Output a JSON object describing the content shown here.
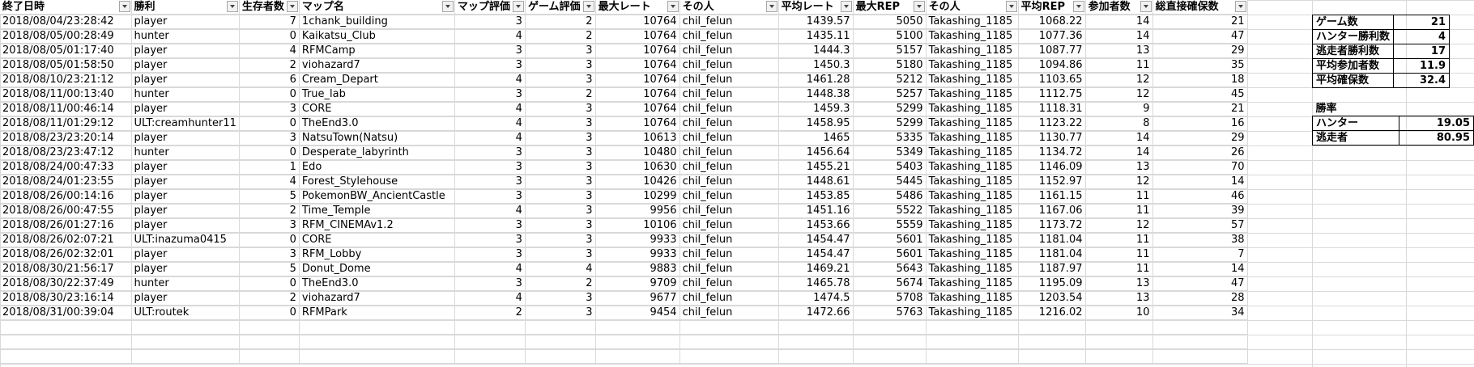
{
  "headers": [
    "終了日時",
    "勝利",
    "生存者数",
    "マップ名",
    "マップ評価",
    "ゲーム評価",
    "最大レート",
    "その人",
    "平均レート",
    "最大REP",
    "その人",
    "平均REP",
    "参加者数",
    "総直接確保数"
  ],
  "rows": [
    [
      "2018/08/04/23:28:42",
      "player",
      "7",
      "1chank_building",
      "3",
      "2",
      "10764",
      "chil_felun",
      "1439.57",
      "5050",
      "Takashing_1185",
      "1068.22",
      "14",
      "21"
    ],
    [
      "2018/08/05/00:28:49",
      "hunter",
      "0",
      "Kaikatsu_Club",
      "4",
      "2",
      "10764",
      "chil_felun",
      "1435.11",
      "5100",
      "Takashing_1185",
      "1077.36",
      "14",
      "47"
    ],
    [
      "2018/08/05/01:17:40",
      "player",
      "4",
      "RFMCamp",
      "3",
      "3",
      "10764",
      "chil_felun",
      "1444.3",
      "5157",
      "Takashing_1185",
      "1087.77",
      "13",
      "29"
    ],
    [
      "2018/08/05/01:58:50",
      "player",
      "2",
      "viohazard7",
      "3",
      "3",
      "10764",
      "chil_felun",
      "1450.3",
      "5180",
      "Takashing_1185",
      "1094.86",
      "11",
      "35"
    ],
    [
      "2018/08/10/23:21:12",
      "player",
      "6",
      "Cream_Depart",
      "4",
      "3",
      "10764",
      "chil_felun",
      "1461.28",
      "5212",
      "Takashing_1185",
      "1103.65",
      "12",
      "18"
    ],
    [
      "2018/08/11/00:13:40",
      "hunter",
      "0",
      "True_lab",
      "3",
      "2",
      "10764",
      "chil_felun",
      "1448.38",
      "5257",
      "Takashing_1185",
      "1112.75",
      "12",
      "45"
    ],
    [
      "2018/08/11/00:46:14",
      "player",
      "3",
      "CORE",
      "4",
      "3",
      "10764",
      "chil_felun",
      "1459.3",
      "5299",
      "Takashing_1185",
      "1118.31",
      "9",
      "21"
    ],
    [
      "2018/08/11/01:29:12",
      "ULT:creamhunter11",
      "0",
      "TheEnd3.0",
      "4",
      "3",
      "10764",
      "chil_felun",
      "1458.95",
      "5299",
      "Takashing_1185",
      "1123.22",
      "8",
      "16"
    ],
    [
      "2018/08/23/23:20:14",
      "player",
      "3",
      "NatsuTown(Natsu)",
      "4",
      "3",
      "10613",
      "chil_felun",
      "1465",
      "5335",
      "Takashing_1185",
      "1130.77",
      "14",
      "29"
    ],
    [
      "2018/08/23/23:47:12",
      "hunter",
      "0",
      "Desperate_labyrinth",
      "3",
      "3",
      "10480",
      "chil_felun",
      "1456.64",
      "5349",
      "Takashing_1185",
      "1134.72",
      "14",
      "26"
    ],
    [
      "2018/08/24/00:47:33",
      "player",
      "1",
      "Edo",
      "3",
      "3",
      "10630",
      "chil_felun",
      "1455.21",
      "5403",
      "Takashing_1185",
      "1146.09",
      "13",
      "70"
    ],
    [
      "2018/08/24/01:23:55",
      "player",
      "4",
      "Forest_Stylehouse",
      "3",
      "3",
      "10426",
      "chil_felun",
      "1448.61",
      "5445",
      "Takashing_1185",
      "1152.97",
      "12",
      "14"
    ],
    [
      "2018/08/26/00:14:16",
      "player",
      "5",
      "PokemonBW_AncientCastle",
      "3",
      "3",
      "10299",
      "chil_felun",
      "1453.85",
      "5486",
      "Takashing_1185",
      "1161.15",
      "11",
      "46"
    ],
    [
      "2018/08/26/00:47:55",
      "player",
      "2",
      "Time_Temple",
      "4",
      "3",
      "9956",
      "chil_felun",
      "1451.16",
      "5522",
      "Takashing_1185",
      "1167.06",
      "11",
      "39"
    ],
    [
      "2018/08/26/01:27:16",
      "player",
      "3",
      "RFM_CINEMAv1.2",
      "3",
      "3",
      "10106",
      "chil_felun",
      "1453.66",
      "5559",
      "Takashing_1185",
      "1173.72",
      "12",
      "57"
    ],
    [
      "2018/08/26/02:07:21",
      "ULT:inazuma0415",
      "0",
      "CORE",
      "3",
      "3",
      "9933",
      "chil_felun",
      "1454.47",
      "5601",
      "Takashing_1185",
      "1181.04",
      "11",
      "38"
    ],
    [
      "2018/08/26/02:32:01",
      "player",
      "3",
      "RFM_Lobby",
      "3",
      "3",
      "9933",
      "chil_felun",
      "1454.47",
      "5601",
      "Takashing_1185",
      "1181.04",
      "11",
      "7"
    ],
    [
      "2018/08/30/21:56:17",
      "player",
      "5",
      "Donut_Dome",
      "4",
      "4",
      "9883",
      "chil_felun",
      "1469.21",
      "5643",
      "Takashing_1185",
      "1187.97",
      "11",
      "14"
    ],
    [
      "2018/08/30/22:37:49",
      "hunter",
      "0",
      "TheEnd3.0",
      "3",
      "2",
      "9709",
      "chil_felun",
      "1465.78",
      "5674",
      "Takashing_1185",
      "1195.09",
      "13",
      "47"
    ],
    [
      "2018/08/30/23:16:14",
      "player",
      "2",
      "viohazard7",
      "4",
      "3",
      "9677",
      "chil_felun",
      "1474.5",
      "5708",
      "Takashing_1185",
      "1203.54",
      "13",
      "28"
    ],
    [
      "2018/08/31/00:39:04",
      "ULT:routek",
      "0",
      "RFMPark",
      "2",
      "3",
      "9454",
      "chil_felun",
      "1472.66",
      "5763",
      "Takashing_1185",
      "1216.02",
      "10",
      "34"
    ]
  ],
  "stats": [
    {
      "label": "ゲーム数",
      "value": "21"
    },
    {
      "label": "ハンター勝利数",
      "value": "4"
    },
    {
      "label": "逃走者勝利数",
      "value": "17"
    },
    {
      "label": "平均参加者数",
      "value": "11.9"
    },
    {
      "label": "平均確保数",
      "value": "32.4"
    }
  ],
  "rate": {
    "title": "勝率",
    "rows": [
      {
        "label": "ハンター",
        "value": "19.05"
      },
      {
        "label": "逃走者",
        "value": "80.95"
      }
    ]
  }
}
